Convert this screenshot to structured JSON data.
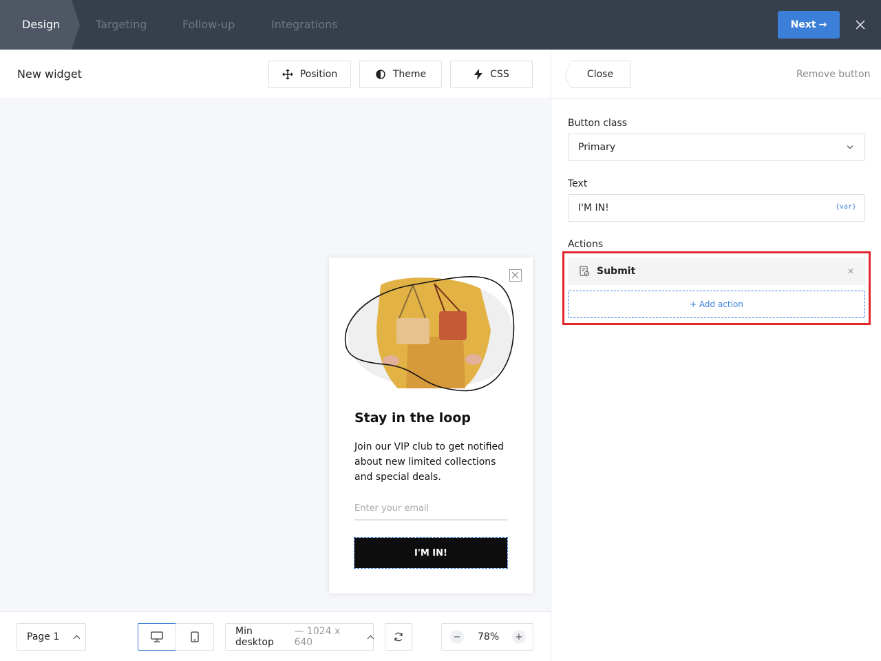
{
  "topbar": {
    "steps": [
      "Design",
      "Targeting",
      "Follow-up",
      "Integrations"
    ],
    "active_step": "Design",
    "next_label": "Next",
    "next_arrow": "→",
    "colors": {
      "background": "#383f4c",
      "active_step": "#4f5664",
      "next_button": "#3b7fd8"
    }
  },
  "toolbar": {
    "title": "New widget",
    "position_label": "Position",
    "theme_label": "Theme",
    "css_label": "CSS"
  },
  "popup": {
    "image_icon": "handbag-model-photo",
    "title": "Stay in the loop",
    "body": "Join our VIP club to get notified about new limited collections and special deals.",
    "email_placeholder": "Enter your email",
    "cta_label": "I'M IN!"
  },
  "bottombar": {
    "page_label": "Page 1",
    "viewport_label": "Min desktop",
    "viewport_size": "— 1024 x 640",
    "zoom": "78%",
    "zoom_minus": "−",
    "zoom_plus": "+"
  },
  "panel": {
    "close_label": "Close",
    "remove_label": "Remove button",
    "button_class_label": "Button class",
    "button_class_value": "Primary",
    "text_label": "Text",
    "text_value": "I'M IN!",
    "var_tag": "{var}",
    "actions_label": "Actions",
    "actions": [
      {
        "label": "Submit",
        "icon": "form-submit-icon"
      }
    ],
    "add_action_label": "+ Add action",
    "highlight_color": "#e0262b"
  }
}
